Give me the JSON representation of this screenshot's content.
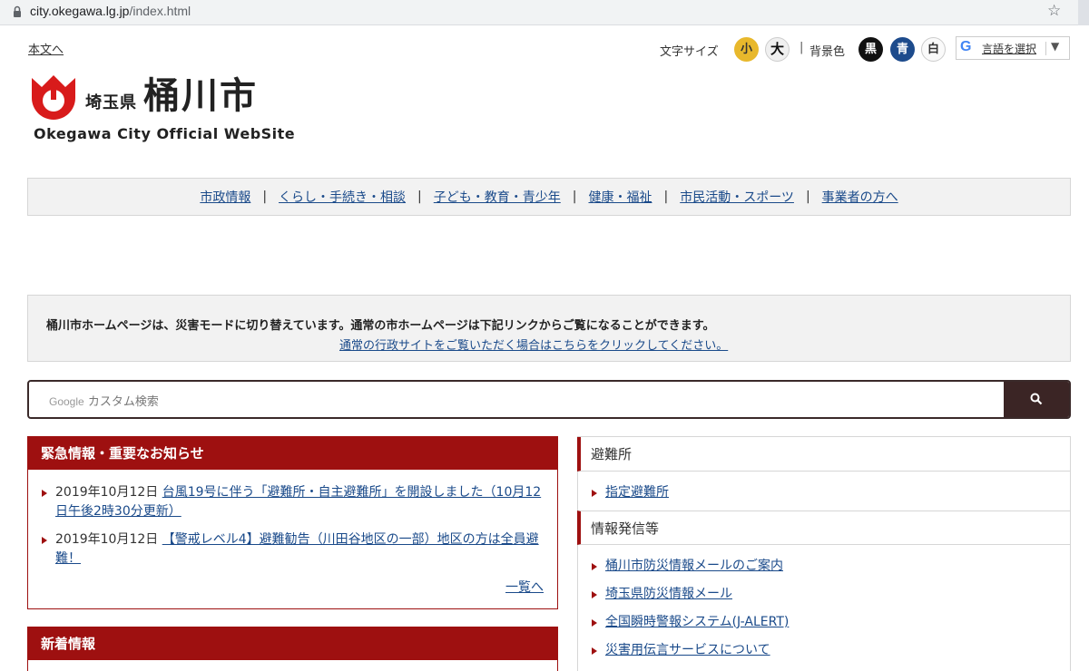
{
  "browser": {
    "url_host": "city.okegawa.lg.jp",
    "url_path": "/index.html"
  },
  "header": {
    "skip_link": "本文へ",
    "font_size_label": "文字サイズ",
    "font_small": "小",
    "font_large": "大",
    "separator": "|",
    "bg_color_label": "背景色",
    "bg_black": "黒",
    "bg_blue": "青",
    "bg_white": "白",
    "translate_g": "G",
    "translate_label": "言語を選択",
    "translate_dropdown": "▼"
  },
  "logo": {
    "prefecture": "埼玉県",
    "city": "桶川市",
    "english": "Okegawa City Official WebSite",
    "colors": {
      "mark": "#d81b1b"
    }
  },
  "nav": {
    "items": [
      {
        "label": "市政情報"
      },
      {
        "label": "くらし・手続き・相談"
      },
      {
        "label": "子ども・教育・青少年"
      },
      {
        "label": "健康・福祉"
      },
      {
        "label": "市民活動・スポーツ"
      },
      {
        "label": "事業者の方へ"
      }
    ],
    "separator": "|"
  },
  "notice": {
    "message": "桶川市ホームページは、災害モードに切り替えています。通常の市ホームページは下記リンクからご覧になることができます。",
    "link": "通常の行政サイトをご覧いただく場合はこちらをクリックしてください。"
  },
  "search": {
    "google_label": "Google",
    "placeholder": "カスタム検索",
    "button_icon": "search-icon"
  },
  "emergency": {
    "title": "緊急情報・重要なお知らせ",
    "items": [
      {
        "date": "2019年10月12日",
        "link": "台風19号に伴う「避難所・自主避難所」を開設しました（10月12日午後2時30分更新）"
      },
      {
        "date": "2019年10月12日",
        "link": "【警戒レベル4】避難勧告（川田谷地区の一部）地区の方は全員避難！"
      }
    ],
    "more_link": "一覧へ"
  },
  "news": {
    "title": "新着情報"
  },
  "side": {
    "sections": [
      {
        "title": "避難所",
        "links": [
          "指定避難所"
        ]
      },
      {
        "title": "情報発信等",
        "links": [
          "桶川市防災情報メールのご案内",
          "埼玉県防災情報メール",
          "全国瞬時警報システム(J-ALERT)",
          "災害用伝言サービスについて"
        ]
      }
    ]
  },
  "colors": {
    "accent_red": "#9e1010",
    "link_blue": "#1a4a8a",
    "font_small_bg": "#e8b82c",
    "bg_blue_btn": "#1d4b8c",
    "search_button": "#3b2525"
  }
}
